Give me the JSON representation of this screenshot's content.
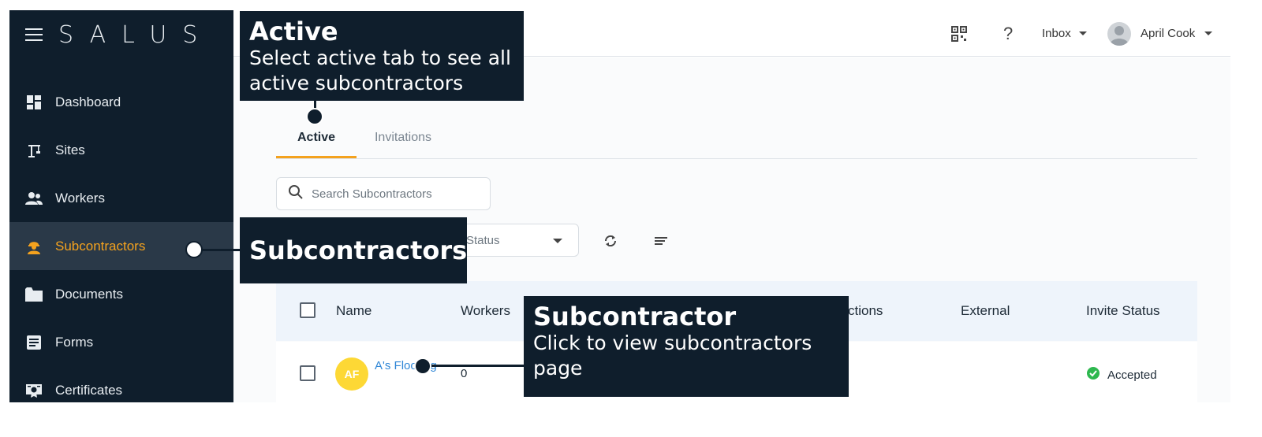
{
  "app": {
    "logo": "SALUS"
  },
  "sidebar": {
    "items": [
      {
        "label": "Dashboard",
        "icon": "dashboard-icon"
      },
      {
        "label": "Sites",
        "icon": "crane-icon"
      },
      {
        "label": "Workers",
        "icon": "people-icon"
      },
      {
        "label": "Subcontractors",
        "icon": "hardhat-worker-icon",
        "active": true
      },
      {
        "label": "Documents",
        "icon": "folder-icon"
      },
      {
        "label": "Forms",
        "icon": "form-icon"
      },
      {
        "label": "Certificates",
        "icon": "certificate-icon"
      }
    ]
  },
  "topbar": {
    "inbox_label": "Inbox",
    "help_label": "?",
    "user_name": "April Cook"
  },
  "tabs": [
    {
      "label": "Active",
      "active": true
    },
    {
      "label": "Invitations",
      "active": false
    }
  ],
  "search": {
    "placeholder": "Search Subcontractors",
    "value": ""
  },
  "filters": {
    "status_placeholder": "Status"
  },
  "table": {
    "columns": [
      "Name",
      "Workers",
      "ctions",
      "External",
      "Invite Status"
    ],
    "rows": [
      {
        "initials": "AF",
        "name": "A's Flooring",
        "workers": "0",
        "invite_status": "Accepted"
      }
    ]
  },
  "callouts": {
    "active": {
      "title": "Active",
      "desc": "Select active tab to see all active subcontractors"
    },
    "subcontractors": {
      "title": "Subcontractors"
    },
    "subcontractor": {
      "title": "Subcontractor",
      "desc": "Click to view subcontractors page"
    }
  },
  "colors": {
    "sidebar_bg": "#0f1e2c",
    "accent": "#f4a21e",
    "link": "#2f86d6",
    "avatar": "#fdd835",
    "status_ok": "#2eb84f"
  }
}
